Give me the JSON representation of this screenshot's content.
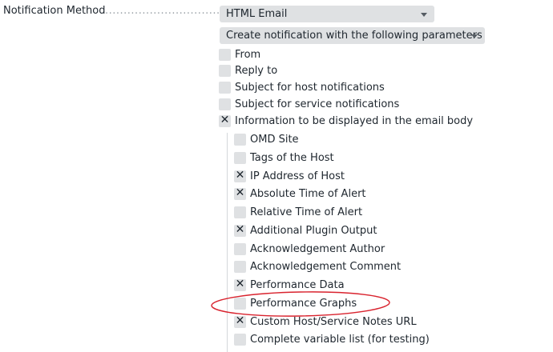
{
  "form": {
    "notification_method_label": "Notification Method",
    "label_dots": "..................................",
    "method_select": {
      "value": "HTML Email"
    },
    "params_select": {
      "value": "Create notification with the following parameters"
    },
    "options": [
      {
        "label": "From",
        "checked": false
      },
      {
        "label": "Reply to",
        "checked": false
      },
      {
        "label": "Subject for host notifications",
        "checked": false
      },
      {
        "label": "Subject for service notifications",
        "checked": false
      },
      {
        "label": "Information to be displayed in the email body",
        "checked": true
      }
    ],
    "body_info_options": [
      {
        "label": "OMD Site",
        "checked": false
      },
      {
        "label": "Tags of the Host",
        "checked": false
      },
      {
        "label": "IP Address of Host",
        "checked": true
      },
      {
        "label": "Absolute Time of Alert",
        "checked": true
      },
      {
        "label": "Relative Time of Alert",
        "checked": false
      },
      {
        "label": "Additional Plugin Output",
        "checked": true
      },
      {
        "label": "Acknowledgement Author",
        "checked": false
      },
      {
        "label": "Acknowledgement Comment",
        "checked": false
      },
      {
        "label": "Performance Data",
        "checked": true
      },
      {
        "label": "Performance Graphs",
        "checked": false
      },
      {
        "label": "Custom Host/Service Notes URL",
        "checked": true
      },
      {
        "label": "Complete variable list (for testing)",
        "checked": false
      }
    ],
    "check_mark": "✕"
  },
  "colors": {
    "checkbox_bg": "#dfe1e3",
    "select_bg": "#dfe1e3",
    "text": "#1e262e",
    "annotation_ellipse": "#d9232e"
  }
}
